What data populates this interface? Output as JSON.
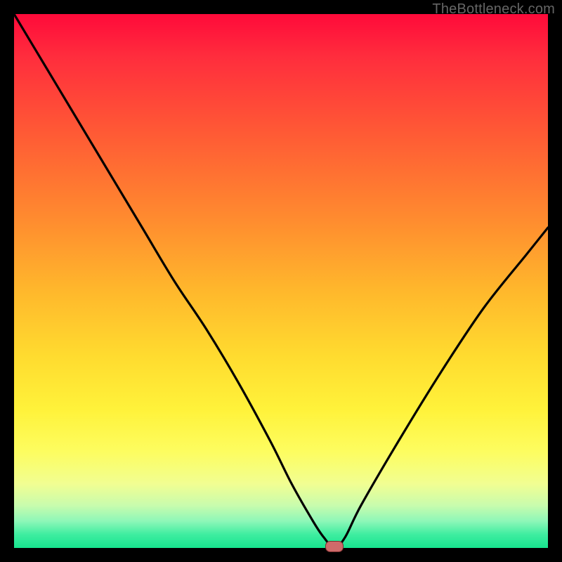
{
  "watermark": "TheBottleneck.com",
  "colors": {
    "frame_bg": "#000000",
    "curve_stroke": "#000000",
    "marker_fill": "#cf6a6a",
    "marker_stroke": "#7a2e2e"
  },
  "chart_data": {
    "type": "line",
    "title": "",
    "xlabel": "",
    "ylabel": "",
    "xlim": [
      0,
      100
    ],
    "ylim": [
      0,
      100
    ],
    "grid": false,
    "background": "rainbow-vertical-gradient (red top → green bottom)",
    "series": [
      {
        "name": "bottleneck-curve",
        "x": [
          0,
          6,
          12,
          18,
          24,
          30,
          36,
          42,
          48,
          52,
          56,
          58,
          60,
          62,
          65,
          72,
          80,
          88,
          96,
          100
        ],
        "y": [
          100,
          90,
          80,
          70,
          60,
          50,
          41,
          31,
          20,
          12,
          5,
          2,
          0,
          2,
          8,
          20,
          33,
          45,
          55,
          60
        ]
      }
    ],
    "marker": {
      "x": 60,
      "y": 0
    },
    "note": "Axis units are relative percentage of the plot area; no numeric tick labels are rendered in the source image."
  }
}
